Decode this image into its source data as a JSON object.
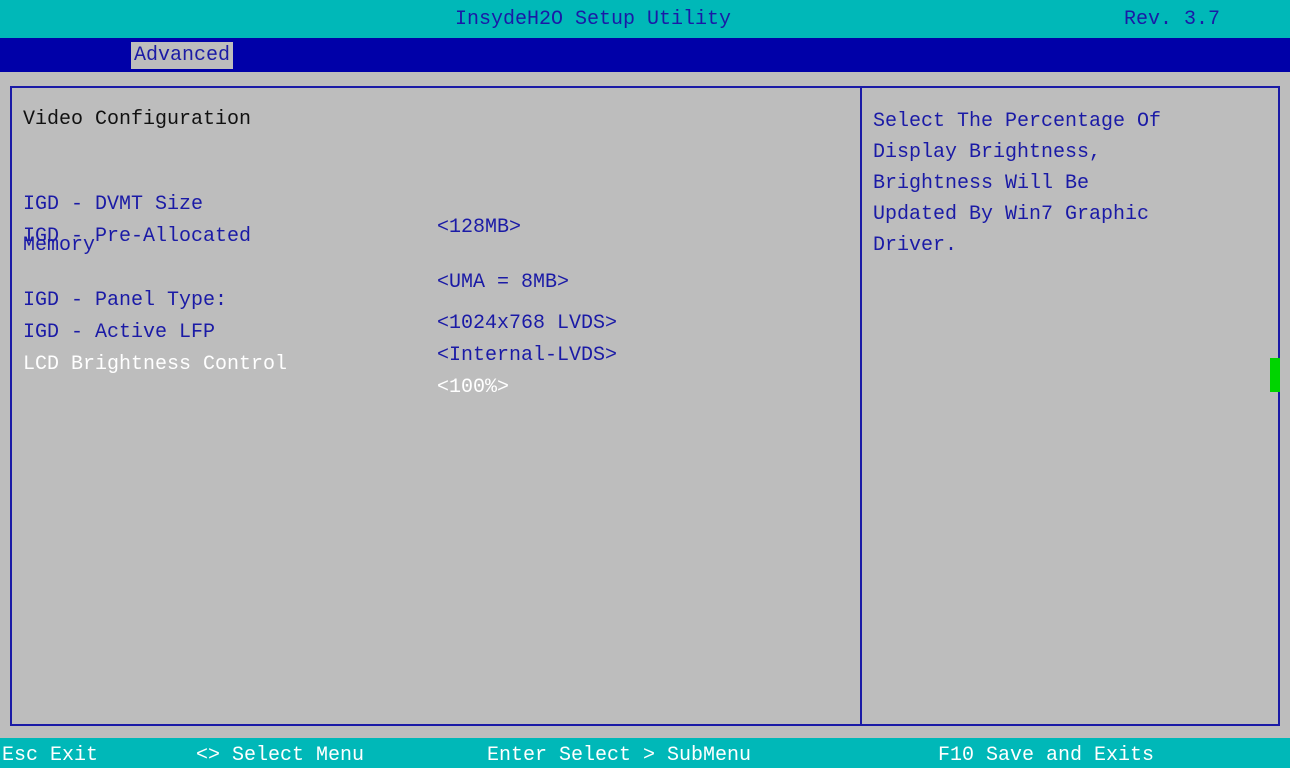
{
  "header": {
    "title": "InsydeH2O Setup Utility",
    "revision": "Rev. 3.7"
  },
  "menu": {
    "tabs": [
      {
        "label": "Advanced",
        "active": true
      }
    ]
  },
  "main": {
    "section_title": "Video Configuration",
    "settings": [
      {
        "label": "IGD - DVMT Size",
        "value": "<128MB>"
      },
      {
        "label": "IGD - Pre-Allocated",
        "label_line2": "Memory",
        "value": "<UMA = 8MB>"
      },
      {
        "label": "IGD - Panel Type:",
        "value": "<1024x768 LVDS>"
      },
      {
        "label": "IGD - Active LFP",
        "value": "<Internal-LVDS>"
      },
      {
        "label": "LCD Brightness Control",
        "value": "<100%>",
        "selected": true
      }
    ]
  },
  "help": {
    "text": "Select The Percentage Of\nDisplay Brightness,\nBrightness Will Be\nUpdated By Win7 Graphic\nDriver."
  },
  "status_bar": {
    "keys": [
      {
        "label": "Esc Exit"
      },
      {
        "label": "<> Select Menu"
      },
      {
        "label": "Enter Select > SubMenu"
      },
      {
        "label": "F10 Save and Exits"
      }
    ]
  },
  "colors": {
    "title_bg": "#00b8b8",
    "menu_bg": "#0000a8",
    "panel_bg": "#bdbdbd",
    "text": "#1a1aa6",
    "highlight_text": "#ffffff",
    "scroll_marker": "#00d400"
  }
}
